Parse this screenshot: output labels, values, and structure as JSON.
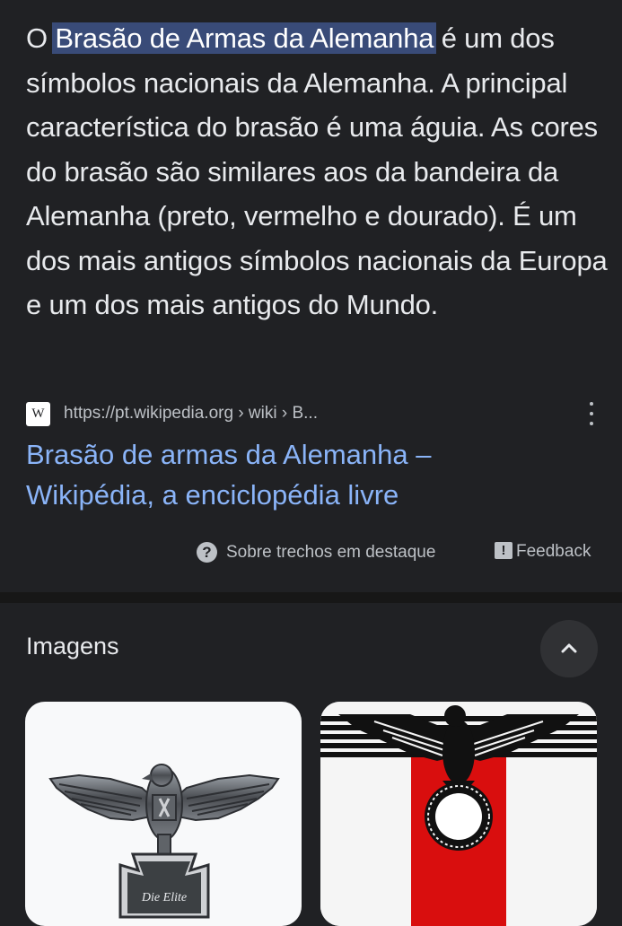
{
  "snippet": {
    "prefix": "O ",
    "highlight": "Brasão de Armas da Alemanha",
    "rest": " é um dos símbolos nacionais da Alemanha. A principal característica do brasão é uma águia. As cores do brasão são similares aos da bandeira da Alemanha (preto, vermelho e dourado). É um dos mais antigos símbolos nacionais da Europa e um dos mais antigos do Mundo."
  },
  "source": {
    "favicon_letter": "W",
    "url": "https://pt.wikipedia.org › wiki › B..."
  },
  "result": {
    "title_line1": "Brasão de armas da Alemanha –",
    "title_line2": "Wikipédia, a enciclopédia livre"
  },
  "footer": {
    "about_label": "Sobre trechos em destaque",
    "about_icon": "?",
    "feedback_label": "Feedback",
    "feedback_icon": "!"
  },
  "images": {
    "heading": "Imagens",
    "card1_text": "Die Elite"
  },
  "colors": {
    "background": "#202124",
    "highlight": "#394b78",
    "link": "#8ab4f8",
    "flag_red": "#d90e0e"
  }
}
